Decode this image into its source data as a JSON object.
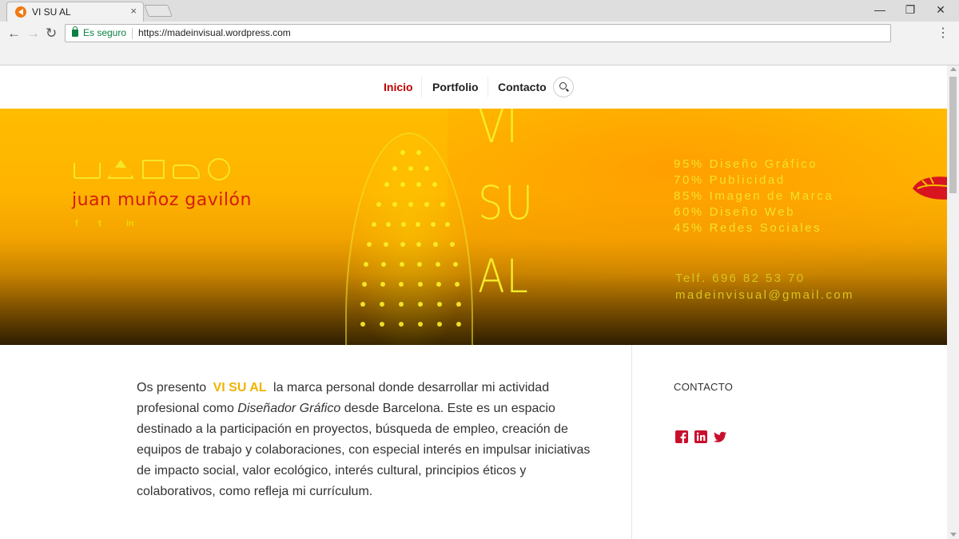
{
  "browser": {
    "tab_title": "VI SU AL",
    "tab_close": "×",
    "secure_label": "Es seguro",
    "url": "https://madeinvisual.wordpress.com",
    "minimize": "—",
    "maximize": "❐",
    "close": "✕",
    "menu": "⋮",
    "back": "←",
    "forward": "→",
    "reload": "↻"
  },
  "nav": {
    "items": [
      {
        "label": "Inicio",
        "active": true
      },
      {
        "label": "Portfolio",
        "active": false
      },
      {
        "label": "Contacto",
        "active": false
      }
    ],
    "search_icon": "search-icon"
  },
  "hero": {
    "brand_name": "juan muñoz gavilón",
    "social": [
      "f",
      "t",
      "in"
    ],
    "visual_words": [
      "VI",
      "SU",
      "AL"
    ],
    "skills": [
      "95% Diseño Gráfico",
      "70% Publicidad",
      "85% Imagen de Marca",
      "60% Diseño Web",
      "45% Redes Sociales"
    ],
    "phone": "Telf. 696 82 53 70",
    "email": "madeinvisual@gmail.com",
    "colors": {
      "accent_yellow": "#f4e22a",
      "brand_red": "#d41c10"
    }
  },
  "content": {
    "intro_pre": "Os presento",
    "intro_brand": "VI SU AL",
    "intro_mid": "la marca personal donde desarrollar mi actividad profesional como",
    "intro_em": "Diseñador Gráfico",
    "intro_post": "desde Barcelona. Este es un espacio destinado a la participación en proyectos, búsqueda de empleo, creación de equipos de trabajo y colaboraciones, con especial interés en impulsar iniciativas de impacto social, valor ecológico, interés cultural, principios éticos y colaborativos, como refleja mi currículum.",
    "sidebar_title": "CONTACTO",
    "sidebar_social": [
      "facebook-icon",
      "linkedin-icon",
      "twitter-icon"
    ],
    "social_color": "#c8102e"
  }
}
